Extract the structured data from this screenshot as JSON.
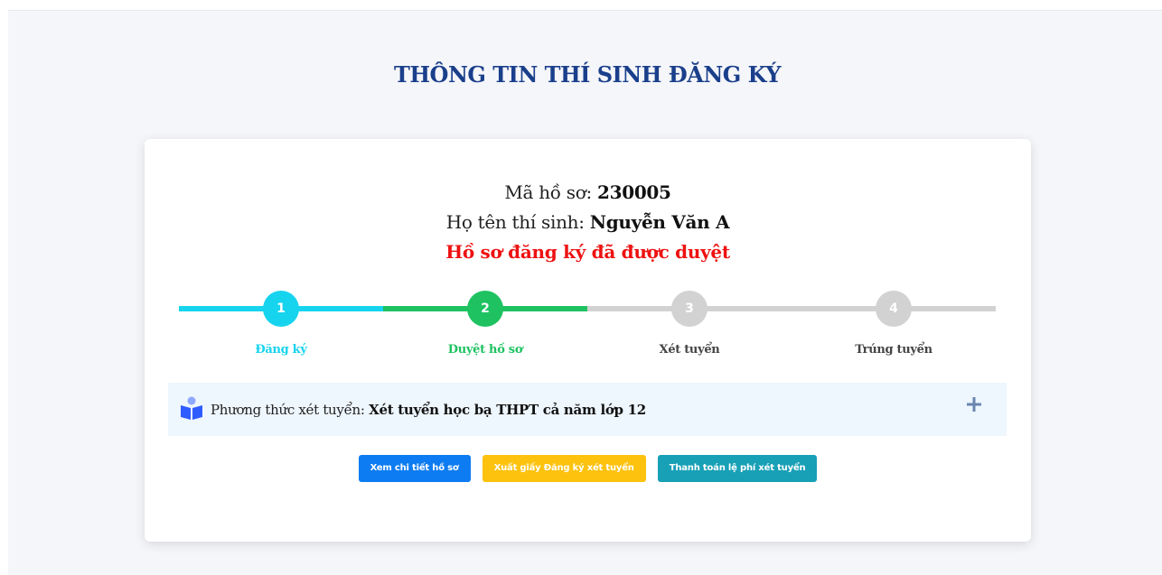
{
  "page": {
    "title": "THÔNG TIN THÍ SINH ĐĂNG KÝ"
  },
  "profile": {
    "code_label": "Mã hồ sơ:",
    "code_value": "230005",
    "name_label": "Họ tên thí sinh:",
    "name_value": "Nguyễn Văn A",
    "status": "Hồ sơ đăng ký đã được duyệt"
  },
  "stepper": {
    "steps": [
      {
        "number": "1",
        "label": "Đăng ký",
        "state": "done",
        "color": "#17d4ee"
      },
      {
        "number": "2",
        "label": "Duyệt hồ sơ",
        "state": "current",
        "color": "#1ec261"
      },
      {
        "number": "3",
        "label": "Xét tuyển",
        "state": "pending",
        "color": "#d2d2d2"
      },
      {
        "number": "4",
        "label": "Trúng tuyển",
        "state": "pending",
        "color": "#d2d2d2"
      }
    ]
  },
  "method": {
    "icon": "reading-book-icon",
    "label": "Phương thức xét tuyển:",
    "value": "Xét tuyển học bạ THPT cả năm lớp 12",
    "expand_icon": "plus-icon"
  },
  "actions": {
    "view_details": "Xem chi tiết hồ sơ",
    "export_form": "Xuất giấy Đăng ký xét tuyển",
    "pay_fee": "Thanh toán lệ phí xét tuyển"
  },
  "colors": {
    "title": "#1a3f8b",
    "status": "#ee1111",
    "btn_blue": "#0d7cf2",
    "btn_yellow": "#fcc20e",
    "btn_teal": "#18a0b6"
  }
}
